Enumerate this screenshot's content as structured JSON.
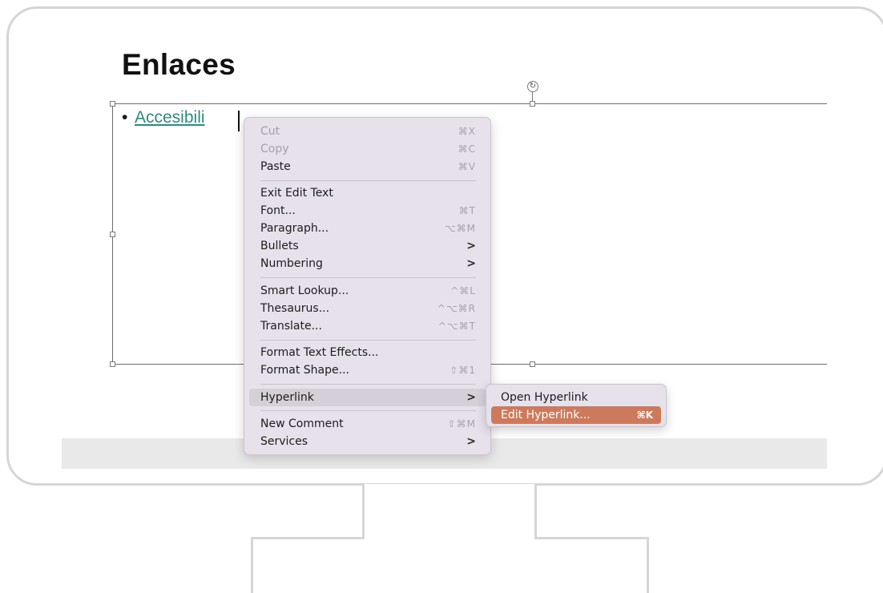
{
  "slide": {
    "title": "Enlaces",
    "bullet": "•",
    "link_text": "Accesibili",
    "rotate_glyph": "↻"
  },
  "context_menu": {
    "items": [
      {
        "label": "Cut",
        "shortcut": "⌘X",
        "disabled": true
      },
      {
        "label": "Copy",
        "shortcut": "⌘C",
        "disabled": true
      },
      {
        "label": "Paste",
        "shortcut": "⌘V"
      },
      {
        "label": "Exit Edit Text",
        "shortcut": ""
      },
      {
        "label": "Font...",
        "shortcut": "⌘T"
      },
      {
        "label": "Paragraph...",
        "shortcut": "⌥⌘M"
      },
      {
        "label": "Bullets",
        "submenu_arrow": ">"
      },
      {
        "label": "Numbering",
        "submenu_arrow": ">"
      },
      {
        "label": "Smart Lookup...",
        "shortcut": "^⌘L"
      },
      {
        "label": "Thesaurus...",
        "shortcut": "^⌥⌘R"
      },
      {
        "label": "Translate...",
        "shortcut": "^⌥⌘T"
      },
      {
        "label": "Format Text Effects...",
        "shortcut": ""
      },
      {
        "label": "Format Shape...",
        "shortcut": "⇧⌘1"
      },
      {
        "label": "Hyperlink",
        "submenu_arrow": ">",
        "highlighted": true
      },
      {
        "label": "New Comment",
        "shortcut": "⇧⌘M"
      },
      {
        "label": "Services",
        "submenu_arrow": ">"
      }
    ]
  },
  "hyperlink_submenu": {
    "items": [
      {
        "label": "Open Hyperlink",
        "shortcut": ""
      },
      {
        "label": "Edit Hyperlink...",
        "shortcut": "⌘K",
        "active": true
      }
    ]
  },
  "colors": {
    "link": "#2e8a80",
    "menu_bg": "#e6e1ea",
    "active_item": "#cd7a5c"
  }
}
